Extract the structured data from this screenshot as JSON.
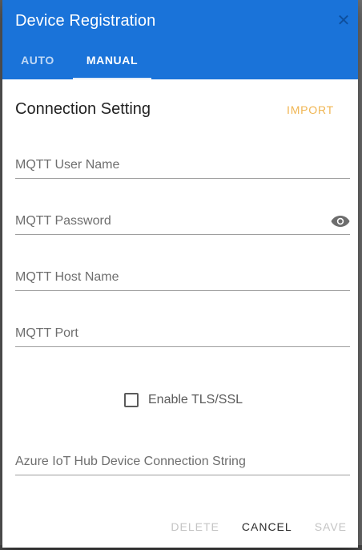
{
  "dialog": {
    "title": "Device Registration",
    "close_icon": "close-icon"
  },
  "tabs": [
    {
      "label": "AUTO",
      "active": false
    },
    {
      "label": "MANUAL",
      "active": true
    }
  ],
  "section": {
    "title": "Connection Setting",
    "import_label": "IMPORT"
  },
  "fields": {
    "mqtt_user": {
      "label": "MQTT User Name",
      "value": ""
    },
    "mqtt_password": {
      "label": "MQTT Password",
      "value": "",
      "toggle_icon": "eye-icon"
    },
    "mqtt_host": {
      "label": "MQTT Host Name",
      "value": ""
    },
    "mqtt_port": {
      "label": "MQTT Port",
      "value": ""
    },
    "azure_conn": {
      "label": "Azure IoT Hub Device Connection String",
      "value": ""
    }
  },
  "tls": {
    "label": "Enable TLS/SSL",
    "checked": false
  },
  "actions": {
    "delete_label": "DELETE",
    "cancel_label": "CANCEL",
    "save_label": "SAVE"
  },
  "colors": {
    "header": "#1a73d9",
    "import": "#f0b552",
    "disabled": "#c4c4c4"
  }
}
